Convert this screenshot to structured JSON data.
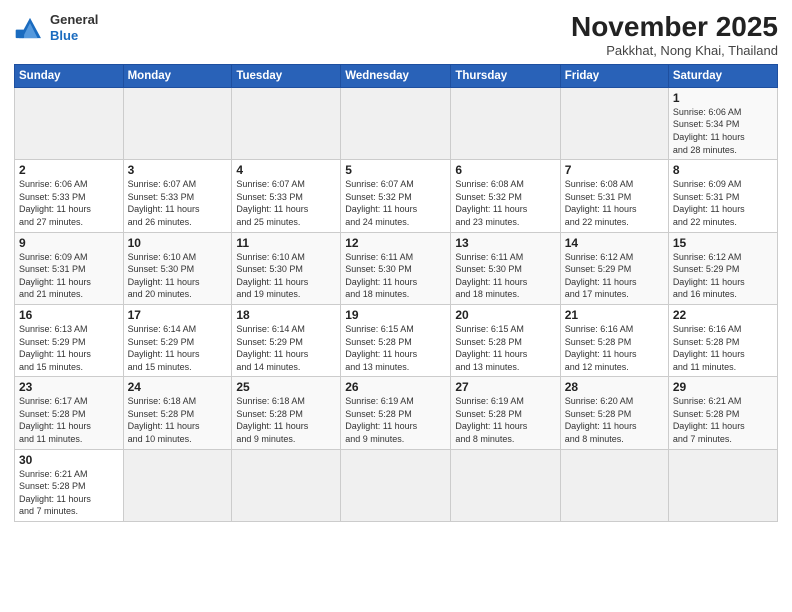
{
  "header": {
    "logo_general": "General",
    "logo_blue": "Blue",
    "month_title": "November 2025",
    "subtitle": "Pakkhat, Nong Khai, Thailand"
  },
  "weekdays": [
    "Sunday",
    "Monday",
    "Tuesday",
    "Wednesday",
    "Thursday",
    "Friday",
    "Saturday"
  ],
  "weeks": [
    [
      {
        "day": "",
        "info": ""
      },
      {
        "day": "",
        "info": ""
      },
      {
        "day": "",
        "info": ""
      },
      {
        "day": "",
        "info": ""
      },
      {
        "day": "",
        "info": ""
      },
      {
        "day": "",
        "info": ""
      },
      {
        "day": "1",
        "info": "Sunrise: 6:06 AM\nSunset: 5:34 PM\nDaylight: 11 hours\nand 28 minutes."
      }
    ],
    [
      {
        "day": "2",
        "info": "Sunrise: 6:06 AM\nSunset: 5:33 PM\nDaylight: 11 hours\nand 27 minutes."
      },
      {
        "day": "3",
        "info": "Sunrise: 6:07 AM\nSunset: 5:33 PM\nDaylight: 11 hours\nand 26 minutes."
      },
      {
        "day": "4",
        "info": "Sunrise: 6:07 AM\nSunset: 5:33 PM\nDaylight: 11 hours\nand 25 minutes."
      },
      {
        "day": "5",
        "info": "Sunrise: 6:07 AM\nSunset: 5:32 PM\nDaylight: 11 hours\nand 24 minutes."
      },
      {
        "day": "6",
        "info": "Sunrise: 6:08 AM\nSunset: 5:32 PM\nDaylight: 11 hours\nand 23 minutes."
      },
      {
        "day": "7",
        "info": "Sunrise: 6:08 AM\nSunset: 5:31 PM\nDaylight: 11 hours\nand 22 minutes."
      },
      {
        "day": "8",
        "info": "Sunrise: 6:09 AM\nSunset: 5:31 PM\nDaylight: 11 hours\nand 22 minutes."
      }
    ],
    [
      {
        "day": "9",
        "info": "Sunrise: 6:09 AM\nSunset: 5:31 PM\nDaylight: 11 hours\nand 21 minutes."
      },
      {
        "day": "10",
        "info": "Sunrise: 6:10 AM\nSunset: 5:30 PM\nDaylight: 11 hours\nand 20 minutes."
      },
      {
        "day": "11",
        "info": "Sunrise: 6:10 AM\nSunset: 5:30 PM\nDaylight: 11 hours\nand 19 minutes."
      },
      {
        "day": "12",
        "info": "Sunrise: 6:11 AM\nSunset: 5:30 PM\nDaylight: 11 hours\nand 18 minutes."
      },
      {
        "day": "13",
        "info": "Sunrise: 6:11 AM\nSunset: 5:30 PM\nDaylight: 11 hours\nand 18 minutes."
      },
      {
        "day": "14",
        "info": "Sunrise: 6:12 AM\nSunset: 5:29 PM\nDaylight: 11 hours\nand 17 minutes."
      },
      {
        "day": "15",
        "info": "Sunrise: 6:12 AM\nSunset: 5:29 PM\nDaylight: 11 hours\nand 16 minutes."
      }
    ],
    [
      {
        "day": "16",
        "info": "Sunrise: 6:13 AM\nSunset: 5:29 PM\nDaylight: 11 hours\nand 15 minutes."
      },
      {
        "day": "17",
        "info": "Sunrise: 6:14 AM\nSunset: 5:29 PM\nDaylight: 11 hours\nand 15 minutes."
      },
      {
        "day": "18",
        "info": "Sunrise: 6:14 AM\nSunset: 5:29 PM\nDaylight: 11 hours\nand 14 minutes."
      },
      {
        "day": "19",
        "info": "Sunrise: 6:15 AM\nSunset: 5:28 PM\nDaylight: 11 hours\nand 13 minutes."
      },
      {
        "day": "20",
        "info": "Sunrise: 6:15 AM\nSunset: 5:28 PM\nDaylight: 11 hours\nand 13 minutes."
      },
      {
        "day": "21",
        "info": "Sunrise: 6:16 AM\nSunset: 5:28 PM\nDaylight: 11 hours\nand 12 minutes."
      },
      {
        "day": "22",
        "info": "Sunrise: 6:16 AM\nSunset: 5:28 PM\nDaylight: 11 hours\nand 11 minutes."
      }
    ],
    [
      {
        "day": "23",
        "info": "Sunrise: 6:17 AM\nSunset: 5:28 PM\nDaylight: 11 hours\nand 11 minutes."
      },
      {
        "day": "24",
        "info": "Sunrise: 6:18 AM\nSunset: 5:28 PM\nDaylight: 11 hours\nand 10 minutes."
      },
      {
        "day": "25",
        "info": "Sunrise: 6:18 AM\nSunset: 5:28 PM\nDaylight: 11 hours\nand 9 minutes."
      },
      {
        "day": "26",
        "info": "Sunrise: 6:19 AM\nSunset: 5:28 PM\nDaylight: 11 hours\nand 9 minutes."
      },
      {
        "day": "27",
        "info": "Sunrise: 6:19 AM\nSunset: 5:28 PM\nDaylight: 11 hours\nand 8 minutes."
      },
      {
        "day": "28",
        "info": "Sunrise: 6:20 AM\nSunset: 5:28 PM\nDaylight: 11 hours\nand 8 minutes."
      },
      {
        "day": "29",
        "info": "Sunrise: 6:21 AM\nSunset: 5:28 PM\nDaylight: 11 hours\nand 7 minutes."
      }
    ],
    [
      {
        "day": "30",
        "info": "Sunrise: 6:21 AM\nSunset: 5:28 PM\nDaylight: 11 hours\nand 7 minutes."
      },
      {
        "day": "",
        "info": ""
      },
      {
        "day": "",
        "info": ""
      },
      {
        "day": "",
        "info": ""
      },
      {
        "day": "",
        "info": ""
      },
      {
        "day": "",
        "info": ""
      },
      {
        "day": "",
        "info": ""
      }
    ]
  ]
}
